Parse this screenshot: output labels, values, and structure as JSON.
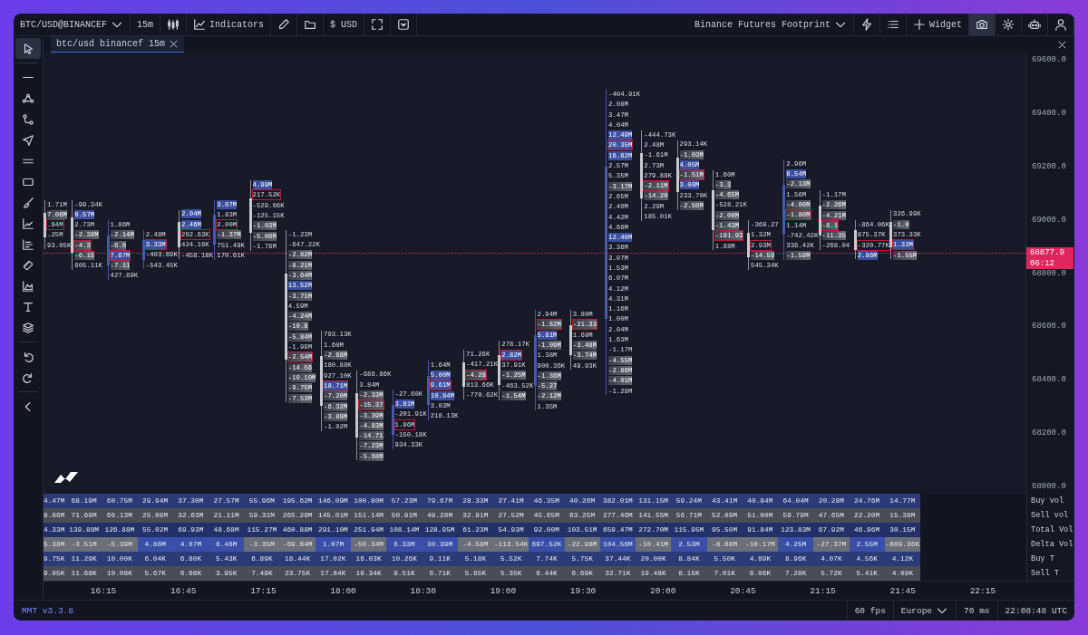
{
  "toolbar": {
    "symbol": "BTC/USD@BINANCEF",
    "interval": "15m",
    "indicators": "Indicators",
    "currency": "$ USD",
    "layout": "Binance Futures Footprint",
    "widget": "Widget",
    "right_tools": [
      {
        "kind": "lightning",
        "selected": false
      },
      {
        "kind": "list",
        "selected": false
      },
      {
        "kind": "camera",
        "selected": true
      },
      {
        "kind": "gear",
        "selected": false
      },
      {
        "kind": "robot",
        "selected": false
      },
      {
        "kind": "user",
        "selected": false
      }
    ]
  },
  "left_tools": [
    {
      "kind": "cursor",
      "selected": true
    },
    {
      "kind": "line",
      "selected": false
    },
    {
      "kind": "nodes",
      "selected": false
    },
    {
      "kind": "path",
      "selected": false
    },
    {
      "kind": "send",
      "selected": false
    },
    {
      "kind": "equals",
      "selected": false
    },
    {
      "kind": "rectangle",
      "selected": false
    },
    {
      "kind": "brush",
      "selected": false
    },
    {
      "kind": "linechart",
      "selected": false
    },
    {
      "kind": "bars",
      "selected": false
    },
    {
      "kind": "ruler",
      "selected": false
    },
    {
      "kind": "areachart",
      "selected": false
    },
    {
      "kind": "text",
      "selected": false
    },
    {
      "kind": "layers",
      "selected": false
    },
    {
      "kind": "undo",
      "selected": false
    },
    {
      "kind": "redo",
      "selected": false
    },
    {
      "kind": "chevron",
      "selected": false
    }
  ],
  "tabs": [
    {
      "label": "btc/usd binancef 15m",
      "selected": true
    }
  ],
  "price_axis": {
    "ticks": [
      "69600.0",
      "69400.0",
      "69200.0",
      "69000.0",
      "68800.0",
      "68600.0",
      "68400.0",
      "68200.0",
      "68000.0"
    ],
    "current_price": "68877.9",
    "countdown": "06:12"
  },
  "footprint": {
    "candles": [
      {
        "kind": "bear",
        "cells": [
          {
            "text": "1.71M",
            "kind": "plain"
          },
          {
            "text": "7.06M",
            "kind": "sell"
          },
          {
            "text": ".94M",
            "kind": "box"
          },
          {
            "text": ".25M",
            "kind": "plain"
          },
          {
            "text": "93.05K",
            "kind": "plain"
          }
        ]
      },
      {
        "kind": "bear",
        "cells": [
          {
            "text": "-99.34K",
            "kind": "plain"
          },
          {
            "text": "6.57M",
            "kind": "buy"
          },
          {
            "text": "2.73M",
            "kind": "plain"
          },
          {
            "text": "-2.38M",
            "kind": "sell"
          },
          {
            "text": "-4.3",
            "kind": "boxsell"
          },
          {
            "text": "-6.15",
            "kind": "sell"
          },
          {
            "text": "605.11K",
            "kind": "plain"
          }
        ]
      },
      {
        "kind": "bull",
        "cells": [
          {
            "text": "1.86M",
            "kind": "plain"
          },
          {
            "text": "-2.14M",
            "kind": "sell"
          },
          {
            "text": "-6.0",
            "kind": "sell"
          },
          {
            "text": "7.67M",
            "kind": "boxbuy"
          },
          {
            "text": "-7.11",
            "kind": "sell"
          },
          {
            "text": "427.89K",
            "kind": "plain"
          }
        ]
      },
      {
        "kind": "bull",
        "cells": [
          {
            "text": "2.48M",
            "kind": "plain"
          },
          {
            "text": "3.33M",
            "kind": "boxbuy"
          },
          {
            "text": "-403.89K",
            "kind": "plain"
          },
          {
            "text": "-543.45K",
            "kind": "plain"
          }
        ]
      },
      {
        "kind": "bear",
        "cells": [
          {
            "text": "2.04M",
            "kind": "buy"
          },
          {
            "text": "2.46M",
            "kind": "buy"
          },
          {
            "text": "202.63K",
            "kind": "box"
          },
          {
            "text": "424.16K",
            "kind": "plain"
          },
          {
            "text": "-458.18K",
            "kind": "plain"
          }
        ]
      },
      {
        "kind": "bull",
        "cells": [
          {
            "text": "3.07M",
            "kind": "buy"
          },
          {
            "text": "1.83M",
            "kind": "plain"
          },
          {
            "text": "2.00M",
            "kind": "box"
          },
          {
            "text": "-1.37M",
            "kind": "sell"
          },
          {
            "text": "751.49K",
            "kind": "plain"
          },
          {
            "text": "170.61K",
            "kind": "plain"
          }
        ]
      },
      {
        "kind": "bear",
        "cells": [
          {
            "text": "4.99M",
            "kind": "buy"
          },
          {
            "text": "217.52K",
            "kind": "box"
          },
          {
            "text": "-529.06K",
            "kind": "plain"
          },
          {
            "text": "-125.15K",
            "kind": "plain"
          },
          {
            "text": "-1.03M",
            "kind": "sell"
          },
          {
            "text": "-5.08M",
            "kind": "sell"
          },
          {
            "text": "-1.78M",
            "kind": "plain"
          }
        ]
      },
      {
        "kind": "bear",
        "cells": [
          {
            "text": "-1.23M",
            "kind": "plain"
          },
          {
            "text": "-647.22K",
            "kind": "plain"
          },
          {
            "text": "-2.82M",
            "kind": "sell"
          },
          {
            "text": "-8.21M",
            "kind": "sell"
          },
          {
            "text": "-3.64M",
            "kind": "sell"
          },
          {
            "text": "13.52M",
            "kind": "buy"
          },
          {
            "text": "-3.71M",
            "kind": "sell"
          },
          {
            "text": "4.59M",
            "kind": "plain"
          },
          {
            "text": "-4.24M",
            "kind": "sell"
          },
          {
            "text": "-10.8",
            "kind": "sell"
          },
          {
            "text": "-5.84M",
            "kind": "sell"
          },
          {
            "text": "-1.99M",
            "kind": "plain"
          },
          {
            "text": "-2.54M",
            "kind": "boxsell"
          },
          {
            "text": "-14.56",
            "kind": "sell"
          },
          {
            "text": "-10.10M",
            "kind": "sell"
          },
          {
            "text": "-9.75M",
            "kind": "sell"
          },
          {
            "text": "-7.53M",
            "kind": "sell"
          }
        ]
      },
      {
        "kind": "bear",
        "cells": [
          {
            "text": "793.13K",
            "kind": "plain"
          },
          {
            "text": "1.60M",
            "kind": "plain"
          },
          {
            "text": "-2.68M",
            "kind": "sell"
          },
          {
            "text": "180.88K",
            "kind": "plain"
          },
          {
            "text": "927.10K",
            "kind": "plain"
          },
          {
            "text": "18.71M",
            "kind": "boxbuy"
          },
          {
            "text": "-7.20M",
            "kind": "sell"
          },
          {
            "text": "-6.32M",
            "kind": "sell"
          },
          {
            "text": "-3.89M",
            "kind": "sell"
          },
          {
            "text": "-1.02M",
            "kind": "plain"
          }
        ]
      },
      {
        "kind": "bear",
        "cells": [
          {
            "text": "-686.86K",
            "kind": "plain"
          },
          {
            "text": "3.84M",
            "kind": "plain"
          },
          {
            "text": "-2.33M",
            "kind": "sell"
          },
          {
            "text": "-15.37",
            "kind": "boxsell"
          },
          {
            "text": "-3.39M",
            "kind": "sell"
          },
          {
            "text": "-4.83M",
            "kind": "sell"
          },
          {
            "text": "-14.71",
            "kind": "sell"
          },
          {
            "text": "-7.23M",
            "kind": "sell"
          },
          {
            "text": "-5.68M",
            "kind": "sell"
          }
        ]
      },
      {
        "kind": "bull",
        "cells": [
          {
            "text": "-27.60K",
            "kind": "plain"
          },
          {
            "text": "3.81M",
            "kind": "buy"
          },
          {
            "text": "-201.91K",
            "kind": "plain"
          },
          {
            "text": "1.96M",
            "kind": "box"
          },
          {
            "text": "-150.18K",
            "kind": "plain"
          },
          {
            "text": "934.33K",
            "kind": "plain"
          }
        ]
      },
      {
        "kind": "bull",
        "cells": [
          {
            "text": "1.64M",
            "kind": "plain"
          },
          {
            "text": "5.00M",
            "kind": "buy"
          },
          {
            "text": "9.61M",
            "kind": "boxbuy"
          },
          {
            "text": "10.84M",
            "kind": "buy"
          },
          {
            "text": "3.03M",
            "kind": "plain"
          },
          {
            "text": "218.13K",
            "kind": "plain"
          }
        ]
      },
      {
        "kind": "bear",
        "cells": [
          {
            "text": "71.26K",
            "kind": "plain"
          },
          {
            "text": "-417.21K",
            "kind": "plain"
          },
          {
            "text": "-4.28",
            "kind": "boxsell"
          },
          {
            "text": "813.66K",
            "kind": "plain"
          },
          {
            "text": "-770.62K",
            "kind": "plain"
          }
        ]
      },
      {
        "kind": "bear",
        "cells": [
          {
            "text": "278.17K",
            "kind": "plain"
          },
          {
            "text": "2.82M",
            "kind": "boxbuy"
          },
          {
            "text": "37.91K",
            "kind": "plain"
          },
          {
            "text": "-1.25M",
            "kind": "sell"
          },
          {
            "text": "-463.52K",
            "kind": "plain"
          },
          {
            "text": "-1.54M",
            "kind": "sell"
          }
        ]
      },
      {
        "kind": "bull",
        "cells": [
          {
            "text": "2.94M",
            "kind": "plain"
          },
          {
            "text": "-1.82M",
            "kind": "boxsell"
          },
          {
            "text": "5.81M",
            "kind": "buy"
          },
          {
            "text": "-1.09M",
            "kind": "sell"
          },
          {
            "text": "1.38M",
            "kind": "plain"
          },
          {
            "text": "900.36K",
            "kind": "plain"
          },
          {
            "text": "-1.36M",
            "kind": "sell"
          },
          {
            "text": "-5.27",
            "kind": "sell"
          },
          {
            "text": "-2.12M",
            "kind": "sell"
          },
          {
            "text": "1.35M",
            "kind": "plain"
          }
        ]
      },
      {
        "kind": "bear",
        "cells": [
          {
            "text": "3.80M",
            "kind": "plain"
          },
          {
            "text": "-21.33",
            "kind": "boxsell"
          },
          {
            "text": "1.69M",
            "kind": "plain"
          },
          {
            "text": "-3.48M",
            "kind": "sell"
          },
          {
            "text": "-3.74M",
            "kind": "sell"
          },
          {
            "text": "49.93K",
            "kind": "plain"
          }
        ]
      },
      {
        "kind": "bull",
        "cells": [
          {
            "text": "-404.91K",
            "kind": "plain"
          },
          {
            "text": "2.08M",
            "kind": "plain"
          },
          {
            "text": "3.47M",
            "kind": "plain"
          },
          {
            "text": "4.04M",
            "kind": "plain"
          },
          {
            "text": "12.49M",
            "kind": "buy"
          },
          {
            "text": "20.35M",
            "kind": "boxbuy"
          },
          {
            "text": "16.82M",
            "kind": "buy"
          },
          {
            "text": "2.57M",
            "kind": "plain"
          },
          {
            "text": "5.35M",
            "kind": "plain"
          },
          {
            "text": "-3.17M",
            "kind": "sell"
          },
          {
            "text": "2.65M",
            "kind": "plain"
          },
          {
            "text": "2.40M",
            "kind": "plain"
          },
          {
            "text": "4.42M",
            "kind": "plain"
          },
          {
            "text": "4.68M",
            "kind": "plain"
          },
          {
            "text": "12.40M",
            "kind": "buy"
          },
          {
            "text": "3.36M",
            "kind": "plain"
          },
          {
            "text": "3.07M",
            "kind": "plain"
          },
          {
            "text": "1.53M",
            "kind": "plain"
          },
          {
            "text": "6.07M",
            "kind": "plain"
          },
          {
            "text": "4.12M",
            "kind": "plain"
          },
          {
            "text": "4.31M",
            "kind": "plain"
          },
          {
            "text": "1.16M",
            "kind": "plain"
          },
          {
            "text": "1.00M",
            "kind": "plain"
          },
          {
            "text": "2.04M",
            "kind": "plain"
          },
          {
            "text": "1.63M",
            "kind": "plain"
          },
          {
            "text": "-1.17M",
            "kind": "plain"
          },
          {
            "text": "-4.55M",
            "kind": "sell"
          },
          {
            "text": "-2.86M",
            "kind": "sell"
          },
          {
            "text": "-4.01M",
            "kind": "sell"
          },
          {
            "text": "-1.28M",
            "kind": "plain"
          }
        ]
      },
      {
        "kind": "bear",
        "cells": [
          {
            "text": "-444.73K",
            "kind": "plain"
          },
          {
            "text": "2.48M",
            "kind": "plain"
          },
          {
            "text": "-1.61M",
            "kind": "plain"
          },
          {
            "text": "2.73M",
            "kind": "plain"
          },
          {
            "text": "279.88K",
            "kind": "plain"
          },
          {
            "text": "-2.11M",
            "kind": "boxsell"
          },
          {
            "text": "-14.20",
            "kind": "sell"
          },
          {
            "text": "2.29M",
            "kind": "plain"
          },
          {
            "text": "185.01K",
            "kind": "plain"
          }
        ]
      },
      {
        "kind": "bear",
        "cells": [
          {
            "text": "293.14K",
            "kind": "plain"
          },
          {
            "text": "-1.03M",
            "kind": "sell"
          },
          {
            "text": "4.05M",
            "kind": "buy"
          },
          {
            "text": "-1.51M",
            "kind": "boxsell"
          },
          {
            "text": "3.08M",
            "kind": "buy"
          },
          {
            "text": "233.70K",
            "kind": "plain"
          },
          {
            "text": "-2.50M",
            "kind": "sell"
          }
        ]
      },
      {
        "kind": "bear",
        "cells": [
          {
            "text": "1.60M",
            "kind": "plain"
          },
          {
            "text": "-3.3",
            "kind": "sell"
          },
          {
            "text": "-4.65M",
            "kind": "sell"
          },
          {
            "text": "-528.21K",
            "kind": "plain"
          },
          {
            "text": "-2.00M",
            "kind": "sell"
          },
          {
            "text": "-1.43M",
            "kind": "sell"
          },
          {
            "text": "-191.93",
            "kind": "boxsell"
          },
          {
            "text": "1.88M",
            "kind": "plain"
          }
        ]
      },
      {
        "kind": "bear",
        "cells": [
          {
            "text": "-369.27",
            "kind": "plain"
          },
          {
            "text": "1.32M",
            "kind": "plain"
          },
          {
            "text": "2.93M",
            "kind": "box"
          },
          {
            "text": "-14.59",
            "kind": "sell"
          },
          {
            "text": "545.34K",
            "kind": "plain"
          }
        ]
      },
      {
        "kind": "bull",
        "cells": [
          {
            "text": "2.96M",
            "kind": "plain"
          },
          {
            "text": "8.54M",
            "kind": "buy"
          },
          {
            "text": "-2.13M",
            "kind": "sell"
          },
          {
            "text": "1.56M",
            "kind": "plain"
          },
          {
            "text": "-4.00M",
            "kind": "sell"
          },
          {
            "text": "-1.80M",
            "kind": "boxsell"
          },
          {
            "text": "1.14M",
            "kind": "plain"
          },
          {
            "text": "-742.42K",
            "kind": "plain"
          },
          {
            "text": "336.42K",
            "kind": "plain"
          },
          {
            "text": "-1.59M",
            "kind": "sell"
          }
        ]
      },
      {
        "kind": "bear",
        "cells": [
          {
            "text": "-1.17M",
            "kind": "plain"
          },
          {
            "text": "-2.26M",
            "kind": "sell"
          },
          {
            "text": "-4.21M",
            "kind": "sell"
          },
          {
            "text": "-8.1",
            "kind": "boxsell"
          },
          {
            "text": "-11.35",
            "kind": "sell"
          },
          {
            "text": "-268.04",
            "kind": "plain"
          }
        ]
      },
      {
        "kind": "bear",
        "cells": [
          {
            "text": "-864.06K",
            "kind": "plain"
          },
          {
            "text": "875.37K",
            "kind": "plain"
          },
          {
            "text": "-320.77K",
            "kind": "box"
          },
          {
            "text": "2.86M",
            "kind": "buy"
          }
        ]
      },
      {
        "kind": "bear",
        "cells": [
          {
            "text": "326.99K",
            "kind": "plain"
          },
          {
            "text": "-1.0",
            "kind": "sell"
          },
          {
            "text": "373.33K",
            "kind": "plain"
          },
          {
            "text": "1.33M",
            "kind": "boxbuy"
          },
          {
            "text": "-1.55M",
            "kind": "sell"
          }
        ]
      }
    ]
  },
  "stats": [
    {
      "label": "Buy vol",
      "kind": "buy",
      "values": [
        "4.47M",
        "68.19M",
        "60.75M",
        "29.94M",
        "37.30M",
        "27.57M",
        "55.96M",
        "195.62M",
        "146.09M",
        "100.80M",
        "57.23M",
        "79.67M",
        "28.33M",
        "27.41M",
        "46.35M",
        "40.26M",
        "382.01M",
        "131.15M",
        "59.24M",
        "43.41M",
        "40.84M",
        "64.04M",
        "20.28M",
        "24.76M",
        "14.77M"
      ]
    },
    {
      "label": "Sell vol",
      "kind": "sell",
      "values": [
        "9.86M",
        "71.69M",
        "66.13M",
        "25.08M",
        "32.63M",
        "21.11M",
        "59.31M",
        "265.26M",
        "145.01M",
        "151.14M",
        "50.91M",
        "49.28M",
        "32.91M",
        "27.52M",
        "45.65M",
        "63.25M",
        "277.46M",
        "141.55M",
        "56.71M",
        "52.09M",
        "51.00M",
        "59.79M",
        "47.65M",
        "22.20M",
        "15.38M"
      ]
    },
    {
      "label": "Total Vol",
      "kind": "total",
      "values": [
        "4.33M",
        "139.88M",
        "126.88M",
        "55.02M",
        "69.93M",
        "48.68M",
        "115.27M",
        "460.88M",
        "291.10M",
        "251.94M",
        "108.14M",
        "128.95M",
        "61.23M",
        "54.93M",
        "92.00M",
        "103.51M",
        "659.47M",
        "272.70M",
        "115.95M",
        "95.50M",
        "91.84M",
        "123.83M",
        "67.92M",
        "46.96M",
        "30.15M"
      ]
    },
    {
      "label": "Delta Vol",
      "kind": "delta",
      "values": [
        {
          "text": "5.38M",
          "kind": "down"
        },
        {
          "text": "-3.51M",
          "kind": "down"
        },
        {
          "text": "-5.39M",
          "kind": "down"
        },
        {
          "text": "4.86M",
          "kind": "up"
        },
        {
          "text": "4.67M",
          "kind": "up"
        },
        {
          "text": "6.46M",
          "kind": "up"
        },
        {
          "text": "-3.35M",
          "kind": "down"
        },
        {
          "text": "-69.64M",
          "kind": "down"
        },
        {
          "text": "1.07M",
          "kind": "up"
        },
        {
          "text": "-50.34M",
          "kind": "down"
        },
        {
          "text": "6.33M",
          "kind": "up"
        },
        {
          "text": "30.39M",
          "kind": "up"
        },
        {
          "text": "-4.58M",
          "kind": "down"
        },
        {
          "text": "-113.54K",
          "kind": "down"
        },
        {
          "text": "697.52K",
          "kind": "up"
        },
        {
          "text": "-22.98M",
          "kind": "down"
        },
        {
          "text": "104.56M",
          "kind": "up"
        },
        {
          "text": "-10.41M",
          "kind": "down"
        },
        {
          "text": "2.53M",
          "kind": "up"
        },
        {
          "text": "-8.68M",
          "kind": "down"
        },
        {
          "text": "-10.17M",
          "kind": "down"
        },
        {
          "text": "4.25M",
          "kind": "up"
        },
        {
          "text": "-27.37M",
          "kind": "down"
        },
        {
          "text": "2.55M",
          "kind": "up"
        },
        {
          "text": "-609.36K",
          "kind": "down"
        }
      ]
    },
    {
      "label": "Buy T",
      "kind": "buy",
      "values": [
        "9.75K",
        "11.29K",
        "10.00K",
        "6.04K",
        "6.80K",
        "5.43K",
        "6.89K",
        "18.44K",
        "17.02K",
        "16.03K",
        "10.26K",
        "9.11K",
        "5.18K",
        "5.52K",
        "7.74K",
        "5.75K",
        "37.44K",
        "20.00K",
        "8.84K",
        "5.50K",
        "4.89K",
        "8.96K",
        "4.07K",
        "4.56K",
        "4.12K"
      ]
    },
    {
      "label": "Sell T",
      "kind": "sell",
      "values": [
        "9.95K",
        "11.68K",
        "10.08K",
        "5.67K",
        "6.66K",
        "3.95K",
        "7.49K",
        "23.75K",
        "17.84K",
        "19.34K",
        "8.51K",
        "6.71K",
        "5.65K",
        "5.35K",
        "6.44K",
        "6.69K",
        "32.71K",
        "19.48K",
        "8.15K",
        "7.01K",
        "6.06K",
        "7.28K",
        "5.72K",
        "5.41K",
        "4.09K"
      ]
    }
  ],
  "time_axis": [
    "16:15",
    "16:45",
    "17:15",
    "18:00",
    "18:30",
    "19:00",
    "19:30",
    "20:00",
    "20:45",
    "21:15",
    "21:45",
    "22:15"
  ],
  "status_bar": {
    "version": "MMT v3.3.8",
    "fps": "60 fps",
    "region": "Europe",
    "latency": "70 ms",
    "clock": "22:08:48 UTC"
  }
}
